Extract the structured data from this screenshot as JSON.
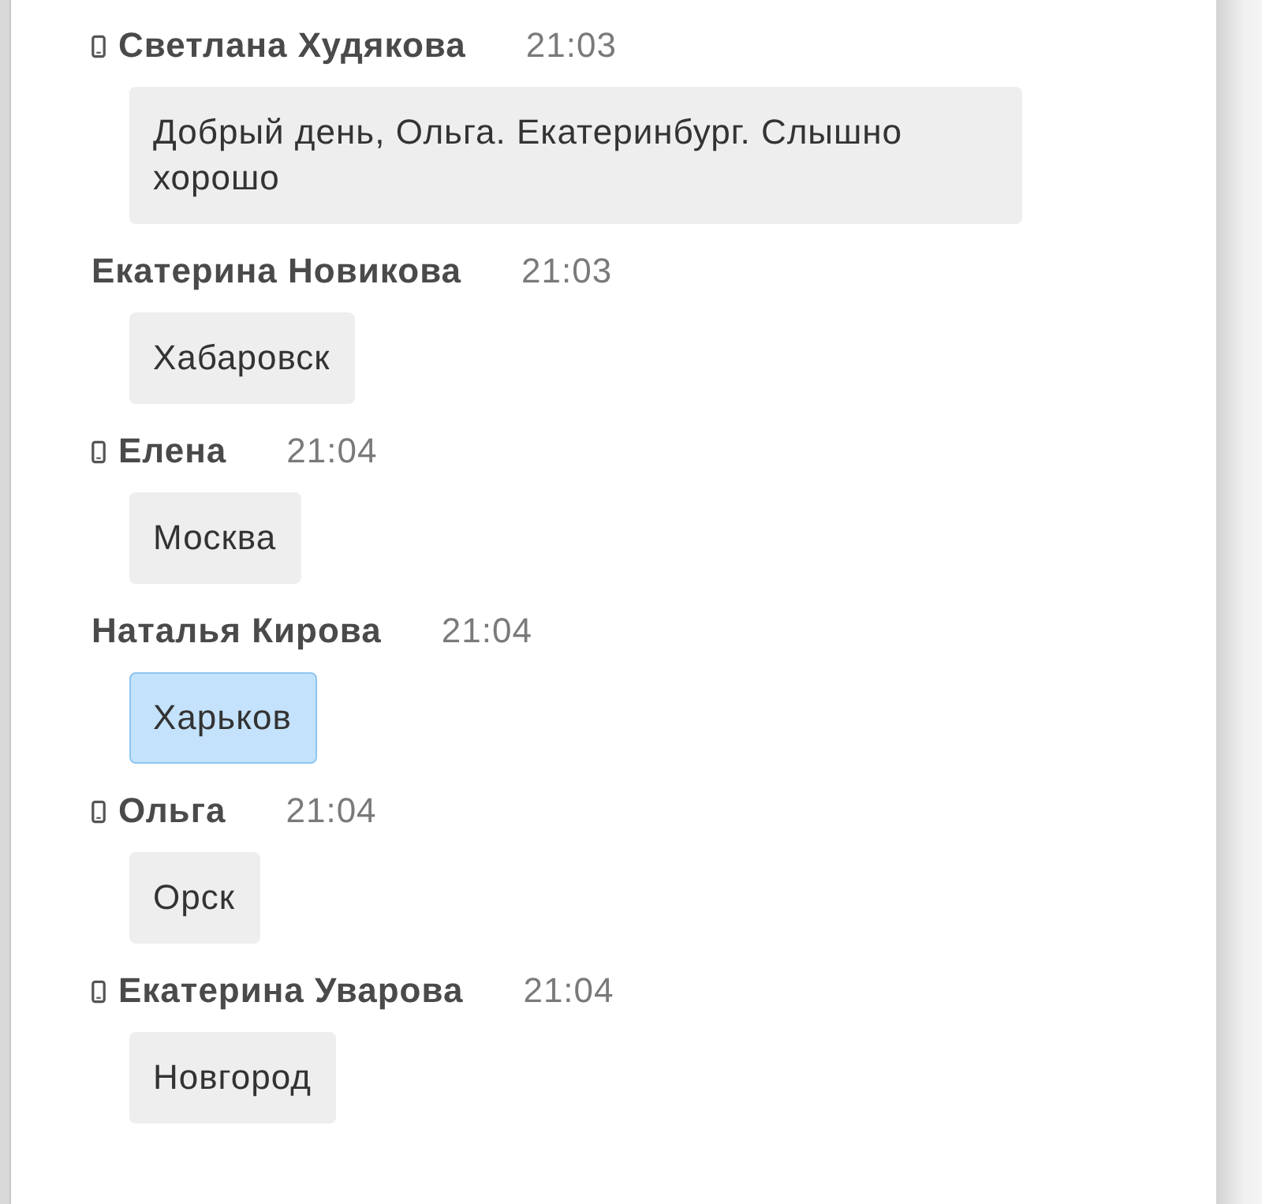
{
  "messages": [
    {
      "phone": true,
      "name": "Светлана Худякова",
      "time": "21:03",
      "text": "Добрый день, Ольга. Екатеринбург. Слышно хорошо",
      "selected": false
    },
    {
      "phone": false,
      "name": "Екатерина Новикова",
      "time": "21:03",
      "text": "Хабаровск",
      "selected": false
    },
    {
      "phone": true,
      "name": "Елена",
      "time": "21:04",
      "text": "Москва",
      "selected": false
    },
    {
      "phone": false,
      "name": "Наталья Кирова",
      "time": "21:04",
      "text": "Харьков",
      "selected": true
    },
    {
      "phone": true,
      "name": "Ольга",
      "time": "21:04",
      "text": "Орск",
      "selected": false
    },
    {
      "phone": true,
      "name": "Екатерина Уварова",
      "time": "21:04",
      "text": "Новгород",
      "selected": false
    }
  ]
}
